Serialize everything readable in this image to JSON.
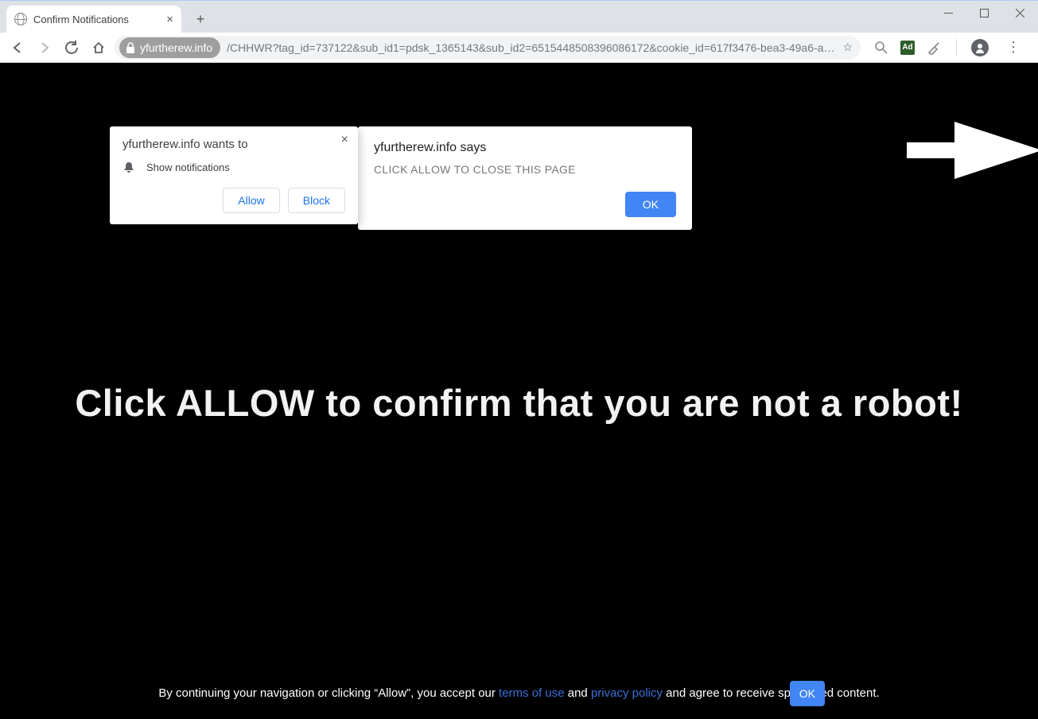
{
  "tab": {
    "title": "Confirm Notifications"
  },
  "address": {
    "domain": "yfurtherew.info",
    "path": "/CHHWR?tag_id=737122&sub_id1=pdsk_1365143&sub_id2=6515448508396086172&cookie_id=617f3476-bea3-49a6-a573-99b3…"
  },
  "notif_prompt": {
    "title": "yfurtherew.info wants to",
    "line": "Show notifications",
    "allow": "Allow",
    "block": "Block"
  },
  "js_alert": {
    "origin": "yfurtherew.info says",
    "message": "CLICK ALLOW TO CLOSE THIS PAGE",
    "ok": "OK"
  },
  "page": {
    "headline": "Click ALLOW to confirm that you are not a robot!",
    "footer_pre": "By continuing your navigation or clicking “Allow”, you accept our ",
    "footer_terms": "terms of use",
    "footer_and": " and ",
    "footer_privacy": "privacy policy",
    "footer_post": " and agree to receive sponsored content.",
    "footer_ok": "OK"
  }
}
